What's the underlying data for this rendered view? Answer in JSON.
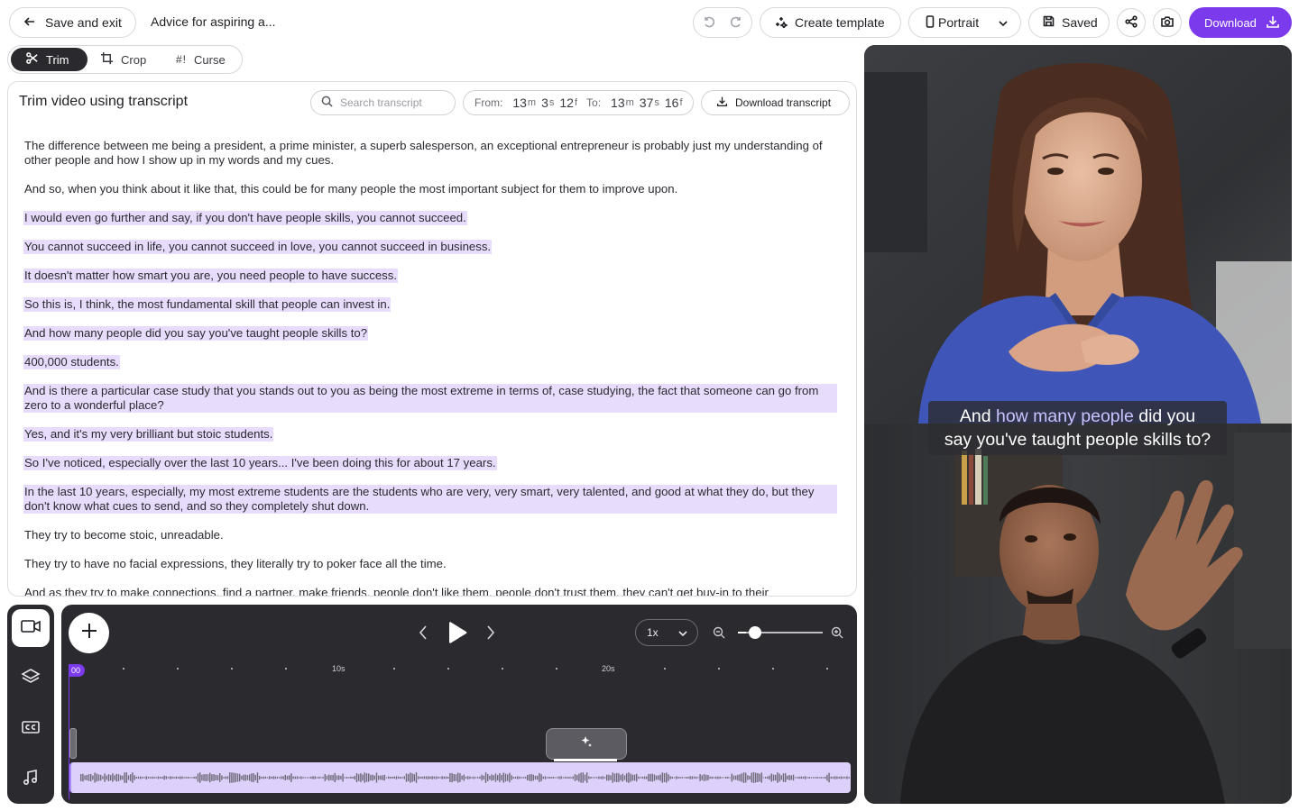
{
  "topbar": {
    "save_exit_label": "Save and exit",
    "doc_title": "Advice for aspiring a...",
    "create_template_label": "Create template",
    "aspect_label": "Portrait",
    "saved_label": "Saved",
    "download_label": "Download",
    "accent_color": "#7c3aed"
  },
  "tools": {
    "trim_label": "Trim",
    "crop_label": "Crop",
    "curse_glyph": "#!",
    "curse_label": "Curse"
  },
  "transcript": {
    "title": "Trim video using transcript",
    "search_placeholder": "Search transcript",
    "range": {
      "from_label": "From:",
      "from_min": "13",
      "from_sec": "3",
      "from_frame": "12",
      "to_label": "To:",
      "to_min": "13",
      "to_sec": "37",
      "to_frame": "16",
      "unit_m": "m",
      "unit_s": "s",
      "unit_f": "f"
    },
    "download_label": "Download transcript",
    "paragraphs": [
      "The difference between me being a president, a prime minister, a superb salesperson, an exceptional entrepreneur is probably just my understanding of other people and how I show up in my words and my cues.",
      "And so, when you think about it like that, this could be for many people the most important subject for them to improve upon.",
      "I would even go further and say, if you don't have people skills, you cannot succeed.",
      "You cannot succeed in life, you cannot succeed in love, you cannot succeed in business.",
      "It doesn't matter how smart you are, you need people to have success.",
      "So this is, I think, the most fundamental skill that people can invest in.",
      "And how many people did you say you've taught people skills to?",
      "400,000 students.",
      "And is there a particular case study that you stands out to you as being the most extreme in terms of, case studying, the fact that someone can go from zero to a wonderful place?",
      "Yes, and it's my very brilliant but stoic students.",
      "So I've noticed, especially over the last 10 years... I've been doing this for about 17 years.",
      "In the last 10 years, especially, my most extreme students are the students who are very, very smart, very talented, and good at what they do, but they don't know what cues to send, and so they completely shut down.",
      "They try to become stoic, unreadable.",
      "They try to have no facial expressions, they literally try to poker face all the time.",
      "And as they try to make connections, find a partner, make friends, people don't like them, people don't trust them, they can't get buy-in to their"
    ]
  },
  "timeline": {
    "speed_label": "1x",
    "zoom_level": 0.1,
    "ruler_labels": [
      "10s",
      "20s"
    ],
    "playhead_label": "00",
    "track_color": "#ddd0fb"
  },
  "preview": {
    "caption_line1_pre": "And ",
    "caption_line1_hl": "how many people",
    "caption_line1_post": " did you",
    "caption_line2": "say you've taught people skills to?"
  }
}
